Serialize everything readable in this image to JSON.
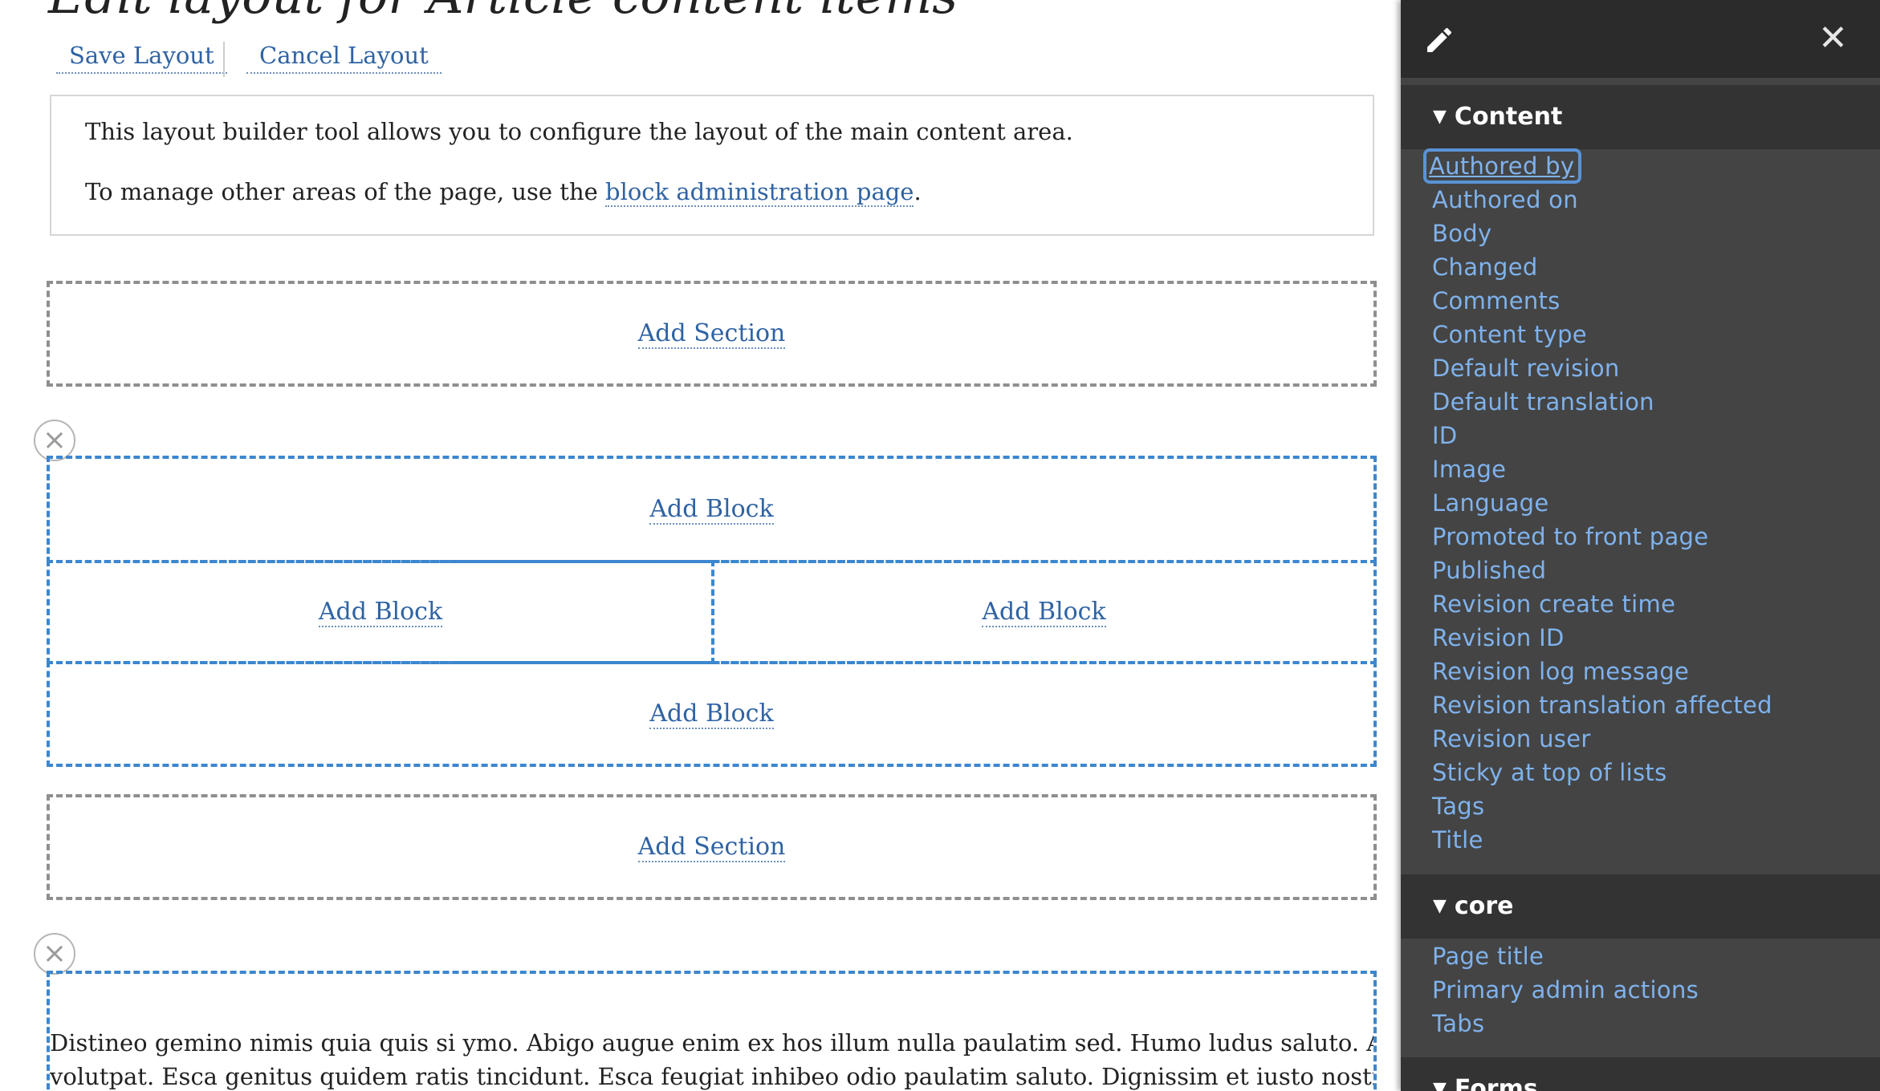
{
  "page": {
    "title": "Edit layout for Article content items"
  },
  "actions": {
    "save": "Save Layout",
    "cancel": "Cancel Layout"
  },
  "help": {
    "line1": "This layout builder tool allows you to configure the layout of the main content area.",
    "line2_prefix": "To manage other areas of the page, use the ",
    "line2_link": "block administration page",
    "line2_suffix": "."
  },
  "sections": {
    "add_section_label": "Add Section",
    "add_block_label": "Add Block",
    "remove_icon": "close-circle-icon"
  },
  "body_text": {
    "line1": "Distineo gemino nimis quia quis si ymo. Abigo augue enim ex hos illum nulla paulatim sed. Humo ludus saluto. At esse gravis sudo",
    "line2": "volutpat. Esca genitus quidem ratis tincidunt. Esca feugiat inhibeo odio paulatim saluto. Dignissim et iusto nostrud quadrum refoveo"
  },
  "sidebar": {
    "edit_icon": "pencil-icon",
    "close_icon": "close-icon",
    "groups": [
      {
        "label": "Content",
        "items": [
          "Authored by",
          "Authored on",
          "Body",
          "Changed",
          "Comments",
          "Content type",
          "Default revision",
          "Default translation",
          "ID",
          "Image",
          "Language",
          "Promoted to front page",
          "Published",
          "Revision create time",
          "Revision ID",
          "Revision log message",
          "Revision translation affected",
          "Revision user",
          "Sticky at top of lists",
          "Tags",
          "Title"
        ]
      },
      {
        "label": "core",
        "items": [
          "Page title",
          "Primary admin actions",
          "Tabs"
        ]
      },
      {
        "label": "Forms",
        "items": []
      }
    ]
  },
  "colors": {
    "link": "#2f63a3",
    "sidebar_bg": "#444444",
    "sidebar_link": "#7fb2ec",
    "region_border": "#3c87cf",
    "section_border": "#8f8f8f"
  }
}
